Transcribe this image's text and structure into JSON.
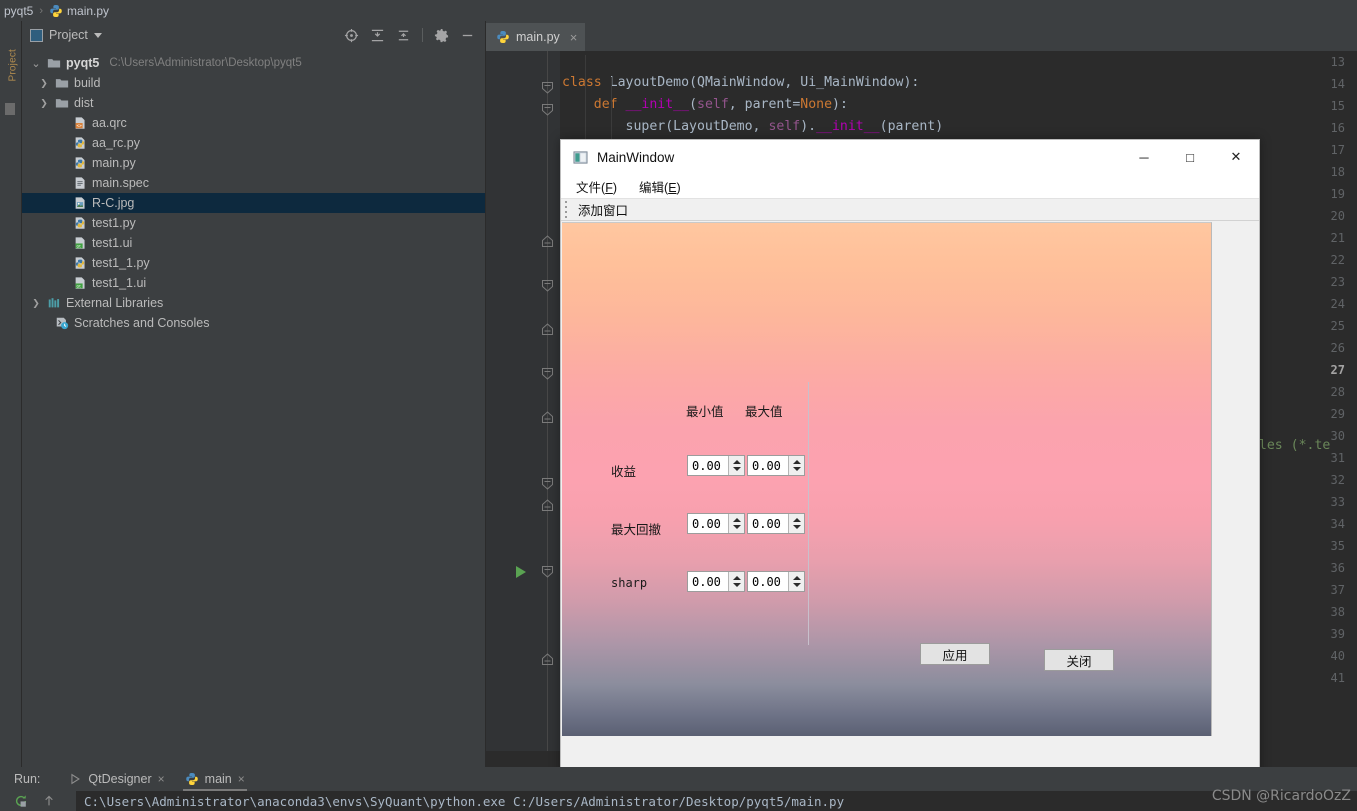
{
  "ide": {
    "breadcrumb": {
      "project": "pyqt5",
      "file": "main.py",
      "separator": "›"
    },
    "left_strip_tab": "Project",
    "project_panel": {
      "title": "Project",
      "tools": [
        "locate-icon",
        "expand-all-icon",
        "collapse-all-icon",
        "gear-icon",
        "minimize-icon"
      ],
      "tree": [
        {
          "label": "pyqt5",
          "path": "C:\\Users\\Administrator\\Desktop\\pyqt5",
          "icon": "folder-icon",
          "arrow": "⌄",
          "indent": 0,
          "bold": true,
          "selected": false
        },
        {
          "label": "build",
          "path": "",
          "icon": "folder-icon",
          "arrow": "›",
          "indent": 1,
          "bold": false,
          "selected": false
        },
        {
          "label": "dist",
          "path": "",
          "icon": "folder-icon",
          "arrow": "›",
          "indent": 1,
          "bold": false,
          "selected": false
        },
        {
          "label": "aa.qrc",
          "path": "",
          "icon": "qrc-file-icon",
          "arrow": "",
          "indent": 2,
          "bold": false,
          "selected": false
        },
        {
          "label": "aa_rc.py",
          "path": "",
          "icon": "python-file-icon",
          "arrow": "",
          "indent": 2,
          "bold": false,
          "selected": false
        },
        {
          "label": "main.py",
          "path": "",
          "icon": "python-file-icon",
          "arrow": "",
          "indent": 2,
          "bold": false,
          "selected": false
        },
        {
          "label": "main.spec",
          "path": "",
          "icon": "text-file-icon",
          "arrow": "",
          "indent": 2,
          "bold": false,
          "selected": false
        },
        {
          "label": "R-C.jpg",
          "path": "",
          "icon": "image-file-icon",
          "arrow": "",
          "indent": 2,
          "bold": false,
          "selected": true
        },
        {
          "label": "test1.py",
          "path": "",
          "icon": "python-file-icon",
          "arrow": "",
          "indent": 2,
          "bold": false,
          "selected": false
        },
        {
          "label": "test1.ui",
          "path": "",
          "icon": "qt-ui-file-icon",
          "arrow": "",
          "indent": 2,
          "bold": false,
          "selected": false
        },
        {
          "label": "test1_1.py",
          "path": "",
          "icon": "python-file-icon",
          "arrow": "",
          "indent": 2,
          "bold": false,
          "selected": false
        },
        {
          "label": "test1_1.ui",
          "path": "",
          "icon": "qt-ui-file-icon",
          "arrow": "",
          "indent": 2,
          "bold": false,
          "selected": false
        },
        {
          "label": "External Libraries",
          "path": "",
          "icon": "libraries-icon",
          "arrow": "›",
          "indent": 0,
          "bold": false,
          "selected": false
        },
        {
          "label": "Scratches and Consoles",
          "path": "",
          "icon": "scratches-icon",
          "arrow": "",
          "indent": 1,
          "bold": false,
          "selected": false
        }
      ]
    },
    "editor": {
      "tab_label": "main.py",
      "tab_close": "×",
      "first_line_number": 13,
      "last_line_number": 41,
      "current_line_number": 27,
      "run_gutter_line": 36,
      "lines": [
        {
          "n": 13,
          "html": ""
        },
        {
          "n": 14,
          "html": "<span class=\"k\">class</span> <span class=\"cls\">LayoutDemo</span>(<span class=\"cls\">QMainWindow</span>, <span class=\"cls\">Ui_MainWindow</span>):"
        },
        {
          "n": 15,
          "html": "    <span class=\"k\">def</span> <span class=\"init\">__init__</span>(<span class=\"self\">self</span>, parent=<span class=\"k\">None</span>):"
        },
        {
          "n": 16,
          "html": "        super(LayoutDemo, <span class=\"self\">self</span>).<span class=\"init\">__init__</span>(parent)"
        }
      ],
      "right_fragment": "Files (*.te"
    },
    "run_panel": {
      "label": "Run:",
      "tabs": [
        {
          "label": "QtDesigner",
          "icon": "run-triangle-icon",
          "close": "×",
          "active": false
        },
        {
          "label": "main",
          "icon": "python-icon",
          "close": "×",
          "active": true
        }
      ],
      "side_icons": [
        "rerun-icon",
        "up-arrow-icon"
      ],
      "console_line": "C:\\Users\\Administrator\\anaconda3\\envs\\SyQuant\\python.exe C:/Users/Administrator/Desktop/pyqt5/main.py"
    }
  },
  "qt_window": {
    "title": "MainWindow",
    "window_buttons": {
      "minimize": "─",
      "maximize": "□",
      "close": "✕"
    },
    "menu": [
      {
        "text": "文件",
        "accel": "F"
      },
      {
        "text": "编辑",
        "accel": "E"
      }
    ],
    "toolbar": {
      "action": "添加窗口"
    },
    "form": {
      "column_headers": [
        "最小值",
        "最大值"
      ],
      "rows": [
        {
          "label": "收益",
          "mono": false,
          "min": "0.00",
          "max": "0.00"
        },
        {
          "label": "最大回撤",
          "mono": false,
          "min": "0.00",
          "max": "0.00"
        },
        {
          "label": "sharp",
          "mono": true,
          "min": "0.00",
          "max": "0.00"
        }
      ],
      "buttons": [
        {
          "name": "apply",
          "label": "应用"
        },
        {
          "name": "close",
          "label": "关闭"
        }
      ]
    },
    "background_gradient": {
      "top": "#ffc7a0",
      "middle": "#fca2b0",
      "bottom": "#5b6073"
    }
  },
  "watermark": "CSDN @RicardoOzZ",
  "colors": {
    "ide_chrome": "#3c3f41",
    "editor_bg": "#2b2b2b",
    "selection": "#0d293e",
    "keyword": "#cc7832",
    "string": "#6a8759",
    "magic_method": "#b200b2",
    "self_keyword": "#94558d",
    "text": "#a9b7c6"
  }
}
